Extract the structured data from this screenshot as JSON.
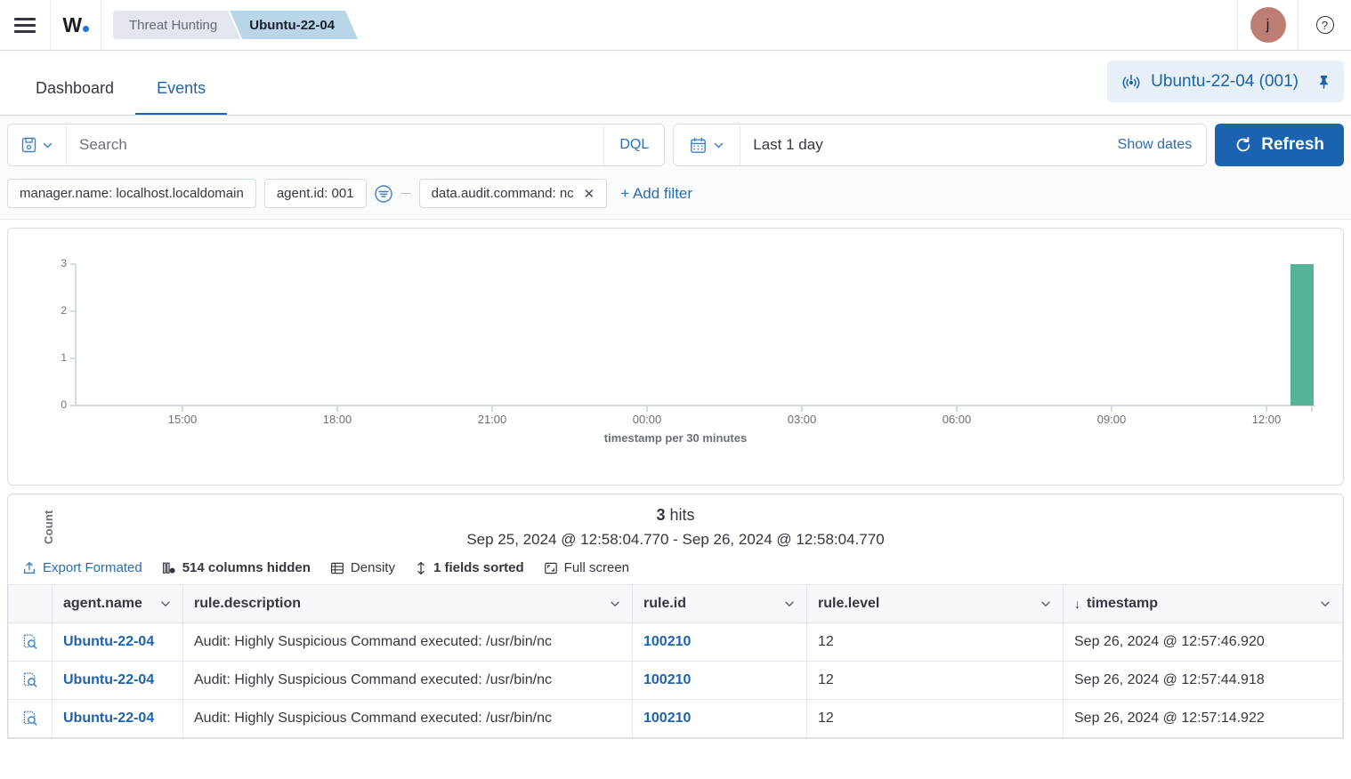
{
  "header": {
    "menu_icon": "hamburger-menu-icon",
    "logo_text": "W.",
    "breadcrumbs": [
      {
        "label": "Threat Hunting"
      },
      {
        "label": "Ubuntu-22-04"
      }
    ],
    "avatar_initial": "j",
    "help_label": "?"
  },
  "tabs": [
    {
      "label": "Dashboard",
      "active": false
    },
    {
      "label": "Events",
      "active": true
    }
  ],
  "agent_selector": {
    "icon": "wifi-signal-icon",
    "label": "Ubuntu-22-04 (001)",
    "pin_icon": "pin-icon"
  },
  "query_bar": {
    "save_icon": "save-floppy-icon",
    "search_placeholder": "Search",
    "search_value": "",
    "language_label": "DQL",
    "calendar_icon": "calendar-icon",
    "date_range": "Last 1 day",
    "show_dates_label": "Show dates",
    "refresh_label": "Refresh",
    "refresh_icon": "refresh-icon",
    "accent_color": "#1b63b0"
  },
  "filters": {
    "pills": [
      {
        "label": "manager.name: localhost.localdomain",
        "removable": false
      },
      {
        "label": "agent.id: 001",
        "removable": false
      },
      {
        "label": "data.audit.command: nc",
        "removable": true,
        "remove_icon": "close-x-icon"
      }
    ],
    "group_icon": "filter-group-icon",
    "add_filter_label": "+ Add filter"
  },
  "chart_data": {
    "type": "bar",
    "title": "",
    "xlabel": "timestamp per 30 minutes",
    "ylabel": "Count",
    "ylim": [
      0,
      3
    ],
    "yticks": [
      "0",
      "1",
      "2",
      "3"
    ],
    "xticks": [
      "15:00",
      "18:00",
      "21:00",
      "00:00",
      "03:00",
      "06:00",
      "09:00",
      "12:00"
    ],
    "grid": false,
    "legend": "none",
    "bar_color": "#54b399",
    "categories": [
      "12:30"
    ],
    "values": [
      3
    ]
  },
  "results": {
    "hits_count": "3",
    "hits_label": "hits",
    "time_range": "Sep 25, 2024 @ 12:58:04.770 - Sep 26, 2024 @ 12:58:04.770",
    "toolbar": [
      {
        "label": "Export Formated",
        "icon": "export-icon",
        "style": "link",
        "bold": false
      },
      {
        "label": "514 columns hidden",
        "icon": "columns-icon",
        "style": "plain",
        "bold": true
      },
      {
        "label": "Density",
        "icon": "density-icon",
        "style": "plain",
        "bold": false
      },
      {
        "label": "1 fields sorted",
        "icon": "sort-icon",
        "style": "plain",
        "bold": true
      },
      {
        "label": "Full screen",
        "icon": "fullscreen-icon",
        "style": "plain",
        "bold": false
      }
    ]
  },
  "table": {
    "expand_icon": "inspect-document-icon",
    "columns": [
      {
        "label": "agent.name",
        "sorted": false,
        "sort_dir": ""
      },
      {
        "label": "rule.description",
        "sorted": false,
        "sort_dir": ""
      },
      {
        "label": "rule.id",
        "sorted": false,
        "sort_dir": ""
      },
      {
        "label": "rule.level",
        "sorted": false,
        "sort_dir": ""
      },
      {
        "label": "timestamp",
        "sorted": true,
        "sort_dir": "↓"
      }
    ],
    "rows": [
      {
        "agent_name": "Ubuntu-22-04",
        "rule_description": "Audit: Highly Suspicious Command executed: /usr/bin/nc",
        "rule_id": "100210",
        "rule_level": "12",
        "timestamp": "Sep 26, 2024 @ 12:57:46.920"
      },
      {
        "agent_name": "Ubuntu-22-04",
        "rule_description": "Audit: Highly Suspicious Command executed: /usr/bin/nc",
        "rule_id": "100210",
        "rule_level": "12",
        "timestamp": "Sep 26, 2024 @ 12:57:44.918"
      },
      {
        "agent_name": "Ubuntu-22-04",
        "rule_description": "Audit: Highly Suspicious Command executed: /usr/bin/nc",
        "rule_id": "100210",
        "rule_level": "12",
        "timestamp": "Sep 26, 2024 @ 12:57:14.922"
      }
    ]
  }
}
